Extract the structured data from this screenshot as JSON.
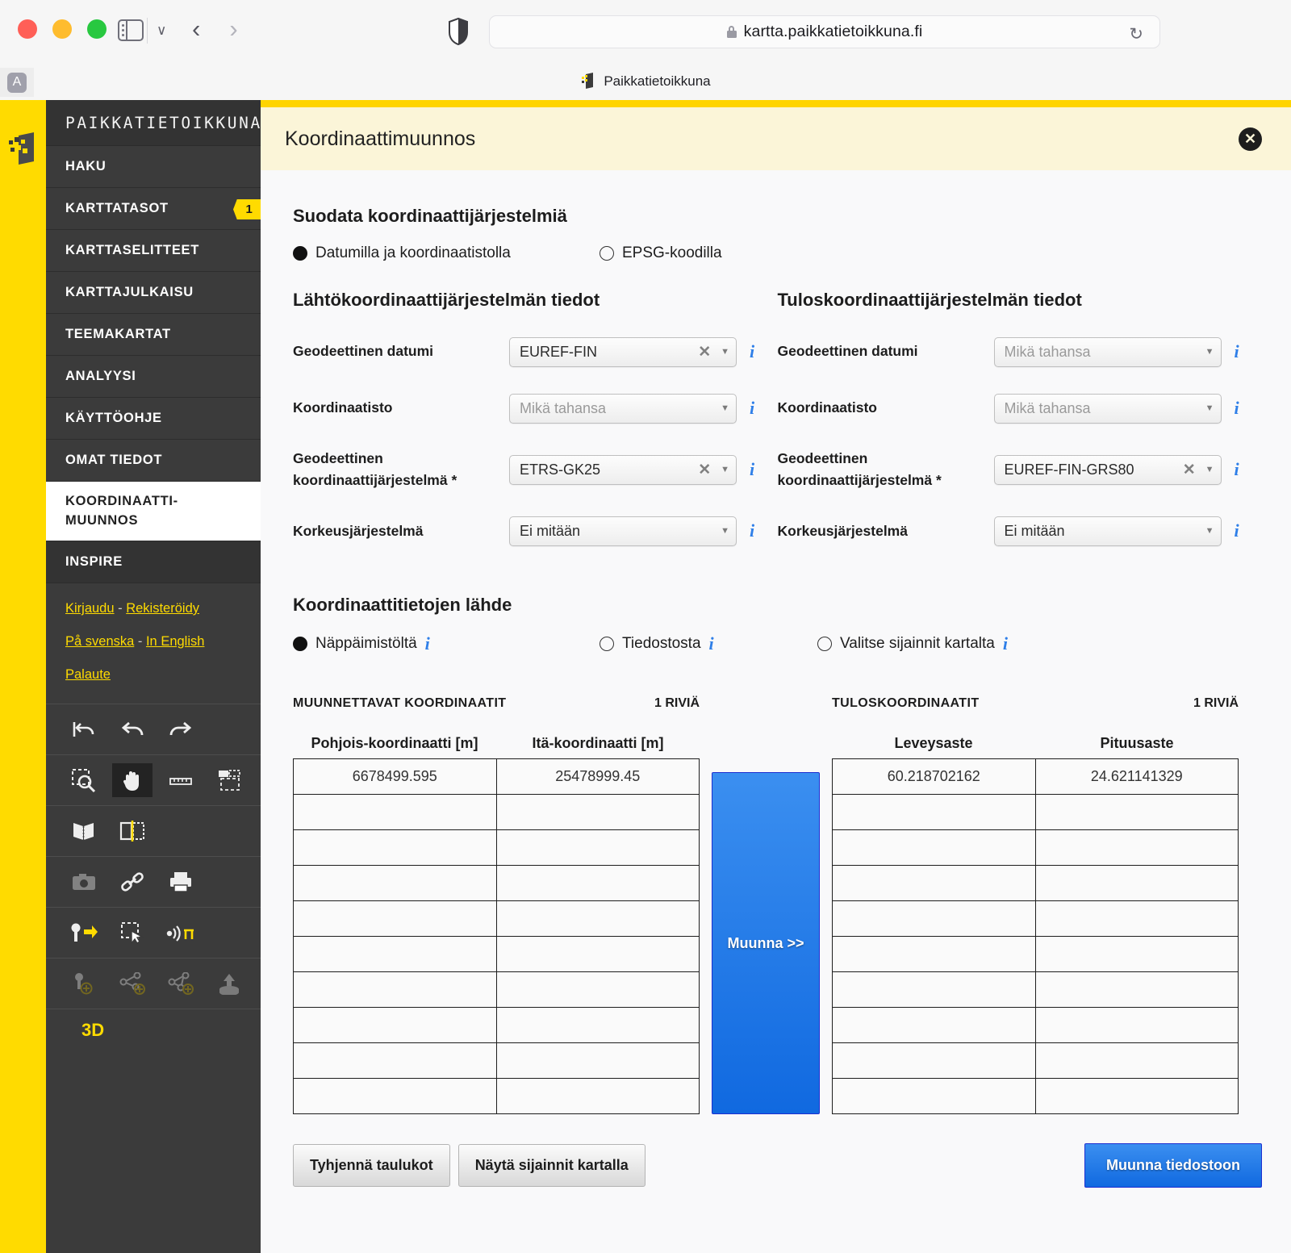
{
  "browser": {
    "url": "kartta.paikkatietoikkuna.fi",
    "tab_title": "Paikkatietoikkuna",
    "bookmark_label": "A",
    "back_glyph": "‹",
    "forward_glyph": "›",
    "reload_glyph": "↻",
    "chevron_glyph": "∨"
  },
  "sidebar": {
    "brand": "PAIKKATIETOIKKUNA",
    "items": [
      {
        "label": "HAKU",
        "badge": ""
      },
      {
        "label": "KARTTATASOT",
        "badge": "1"
      },
      {
        "label": "KARTTASELITTEET",
        "badge": ""
      },
      {
        "label": "KARTTAJULKAISU",
        "badge": ""
      },
      {
        "label": "TEEMAKARTAT",
        "badge": ""
      },
      {
        "label": "ANALYYSI",
        "badge": ""
      },
      {
        "label": "KÄYTTÖOHJE",
        "badge": ""
      },
      {
        "label": "OMAT TIEDOT",
        "badge": ""
      }
    ],
    "active_item_line1": "KOORDINAATTI-",
    "active_item_line2": "MUUNNOS",
    "inspire_label": "INSPIRE",
    "links": {
      "login": "Kirjaudu",
      "sep1": " - ",
      "register": "Rekisteröidy",
      "swedish": "På svenska",
      "sep2": " - ",
      "english": "In English",
      "feedback": "Palaute"
    },
    "tool_3d_label": "3D"
  },
  "panel": {
    "title": "Koordinaattimuunnos",
    "close_glyph": "✕"
  },
  "filter": {
    "heading": "Suodata koordinaattijärjestelmiä",
    "option_datum": "Datumilla ja koordinaatistolla",
    "option_epsg": "EPSG-koodilla",
    "selected": "datum"
  },
  "source_system": {
    "heading": "Lähtökoordinaattijärjestelmän tiedot",
    "fields": [
      {
        "label": "Geodeettinen datumi",
        "value": "EUREF-FIN",
        "placeholder": false,
        "clearable": true
      },
      {
        "label": "Koordinaatisto",
        "value": "Mikä tahansa",
        "placeholder": true,
        "clearable": false
      },
      {
        "label": "Geodeettinen koordinaattijärjestelmä *",
        "value": "ETRS-GK25",
        "placeholder": false,
        "clearable": true
      },
      {
        "label": "Korkeusjärjestelmä",
        "value": "Ei mitään",
        "placeholder": false,
        "clearable": false
      }
    ]
  },
  "target_system": {
    "heading": "Tuloskoordinaattijärjestelmän tiedot",
    "fields": [
      {
        "label": "Geodeettinen datumi",
        "value": "Mikä tahansa",
        "placeholder": true,
        "clearable": false
      },
      {
        "label": "Koordinaatisto",
        "value": "Mikä tahansa",
        "placeholder": true,
        "clearable": false
      },
      {
        "label": "Geodeettinen koordinaattijärjestelmä *",
        "value": "EUREF-FIN-GRS80",
        "placeholder": false,
        "clearable": true
      },
      {
        "label": "Korkeusjärjestelmä",
        "value": "Ei mitään",
        "placeholder": false,
        "clearable": false
      }
    ]
  },
  "data_source": {
    "heading": "Koordinaattitietojen lähde",
    "option_keyboard": "Näppäimistöltä",
    "option_file": "Tiedostosta",
    "option_map": "Valitse sijainnit kartalta",
    "selected": "keyboard"
  },
  "input_table": {
    "title": "MUUNNETTAVAT KOORDINAATIT",
    "row_count": "1 RIVIÄ",
    "columns": [
      "Pohjois-koordinaatti [m]",
      "Itä-koordinaatti [m]"
    ],
    "rows": [
      [
        "6678499.595",
        "25478999.45"
      ],
      [
        "",
        ""
      ],
      [
        "",
        ""
      ],
      [
        "",
        ""
      ],
      [
        "",
        ""
      ],
      [
        "",
        ""
      ],
      [
        "",
        ""
      ],
      [
        "",
        ""
      ],
      [
        "",
        ""
      ],
      [
        "",
        ""
      ]
    ]
  },
  "output_table": {
    "title": "TULOSKOORDINAATIT",
    "row_count": "1 RIVIÄ",
    "columns": [
      "Leveysaste",
      "Pituusaste"
    ],
    "rows": [
      [
        "60.218702162",
        "24.621141329"
      ],
      [
        "",
        ""
      ],
      [
        "",
        ""
      ],
      [
        "",
        ""
      ],
      [
        "",
        ""
      ],
      [
        "",
        ""
      ],
      [
        "",
        ""
      ],
      [
        "",
        ""
      ],
      [
        "",
        ""
      ],
      [
        "",
        ""
      ]
    ]
  },
  "actions": {
    "convert": "Muunna >>",
    "clear_tables": "Tyhjennä taulukot",
    "show_on_map": "Näytä sijainnit kartalla",
    "convert_to_file": "Muunna tiedostoon"
  },
  "colors": {
    "brand_yellow": "#ffdb00",
    "header_cream": "#fbf5d8",
    "accent_blue": "#1069e0",
    "info_blue": "#2f7fe8",
    "menu_dark": "#3b3b3b"
  }
}
